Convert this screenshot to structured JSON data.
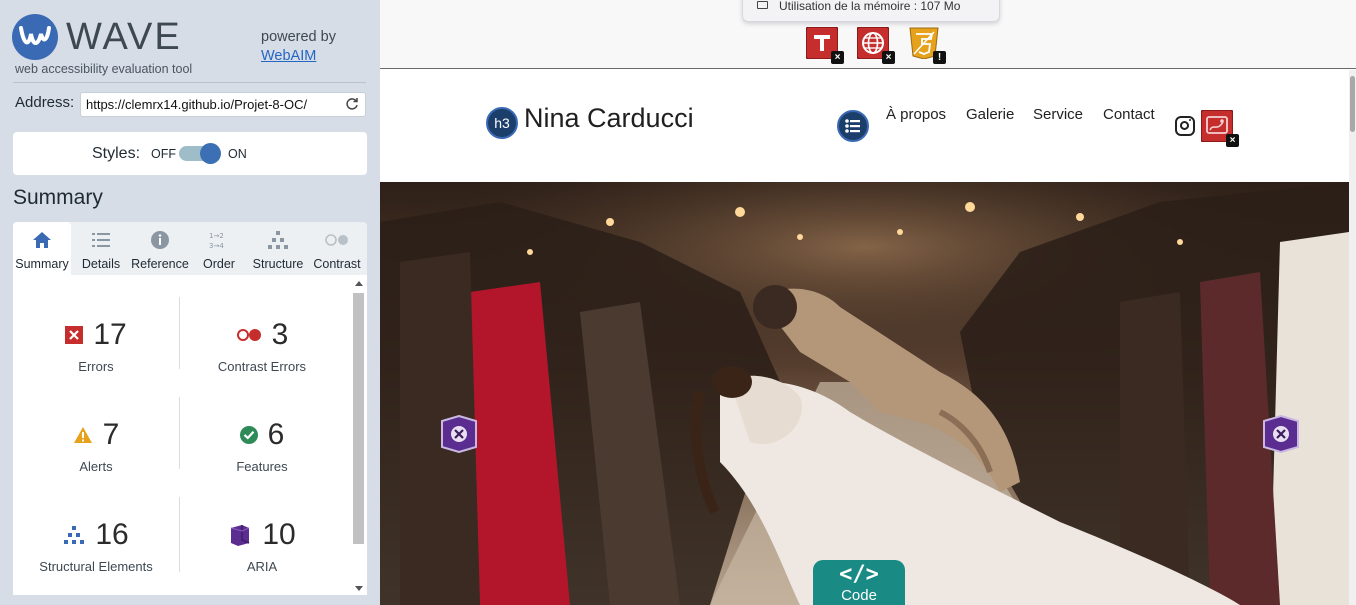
{
  "wave": {
    "logo_text": "WAVE",
    "tagline": "web accessibility evaluation tool",
    "powered_by": "powered by",
    "webaim_link": "WebAIM",
    "address_label": "Address:",
    "address_value": "https://clemrx14.github.io/Projet-8-OC/",
    "styles_label": "Styles:",
    "styles_off": "OFF",
    "styles_on": "ON",
    "styles_enabled": true,
    "summary_title": "Summary",
    "tabs": [
      {
        "label": "Summary",
        "icon": "home-icon",
        "active": true
      },
      {
        "label": "Details",
        "icon": "list-icon",
        "active": false
      },
      {
        "label": "Reference",
        "icon": "info-icon",
        "active": false
      },
      {
        "label": "Order",
        "icon": "order-icon",
        "active": false
      },
      {
        "label": "Structure",
        "icon": "structure-icon",
        "active": false
      },
      {
        "label": "Contrast",
        "icon": "contrast-icon",
        "active": false
      }
    ],
    "stats": {
      "errors": {
        "count": "17",
        "label": "Errors",
        "color": "#c62e2e"
      },
      "contrast_errors": {
        "count": "3",
        "label": "Contrast Errors",
        "color": "#c62e2e"
      },
      "alerts": {
        "count": "7",
        "label": "Alerts",
        "color": "#e6a11d"
      },
      "features": {
        "count": "6",
        "label": "Features",
        "color": "#2e8b57"
      },
      "structural": {
        "count": "16",
        "label": "Structural Elements",
        "color": "#3b6ab5"
      },
      "aria": {
        "count": "10",
        "label": "ARIA",
        "color": "#5b2d91"
      }
    }
  },
  "preview": {
    "tooltip_text": "Utilisation de la mémoire : 107 Mo",
    "h3_badge": "h3",
    "site_title": "Nina Carducci",
    "nav": [
      "À propos",
      "Galerie",
      "Service",
      "Contact"
    ],
    "code_label": "Code",
    "code_glyph": "</>"
  }
}
